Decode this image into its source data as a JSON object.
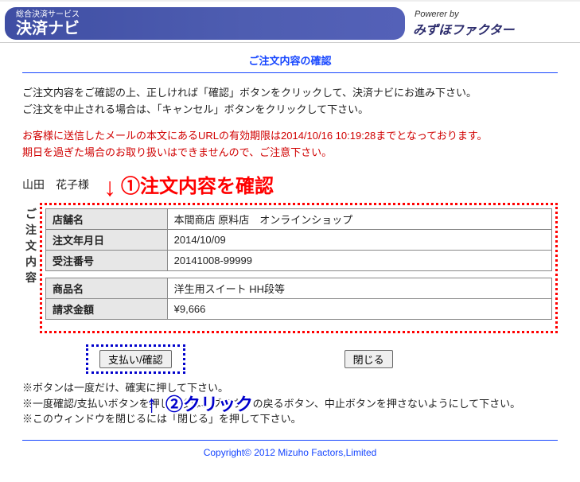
{
  "header": {
    "brand_sub": "総合決済サービス",
    "brand_main": "決済ナビ",
    "powered_label": "Powerer by",
    "powered_name": "みずほファクター"
  },
  "page_title": "ご注文内容の確認",
  "intro": {
    "line1": "ご注文内容をご確認の上、正しければ「確認」ボタンをクリックして、決済ナビにお進み下さい。",
    "line2": "ご注文を中止される場合は、「キャンセル」ボタンをクリックして下さい。"
  },
  "warning": {
    "line1": "お客様に送信したメールの本文にあるURLの有効期限は2014/10/16 10:19:28までとなっております。",
    "line2": "期日を過ぎた場合のお取り扱いはできませんので、ご注意下さい。"
  },
  "customer_name": "山田　花子様",
  "annotations": {
    "step1": "①注文内容を確認",
    "step2": "②クリック"
  },
  "side_label": "ご注文内容",
  "order": {
    "labels": {
      "shop": "店舗名",
      "date": "注文年月日",
      "number": "受注番号",
      "product": "商品名",
      "amount": "請求金額"
    },
    "shop": "本間商店 原料店　オンラインショップ",
    "date": "2014/10/09",
    "number": "20141008-99999",
    "product": "洋生用スイート HH段等",
    "amount": "¥9,666"
  },
  "buttons": {
    "confirm": "支払い/確認",
    "close": "閉じる"
  },
  "notes": {
    "line1": "※ボタンは一度だけ、確実に押して下さい。",
    "line2": "※一度確認/支払いボタンを押した後は、ブラウザの戻るボタン、中止ボタンを押さないようにして下さい。",
    "line3": "※このウィンドウを閉じるには「閉じる」を押して下さい。"
  },
  "footer": "Copyright© 2012 Mizuho Factors,Limited"
}
